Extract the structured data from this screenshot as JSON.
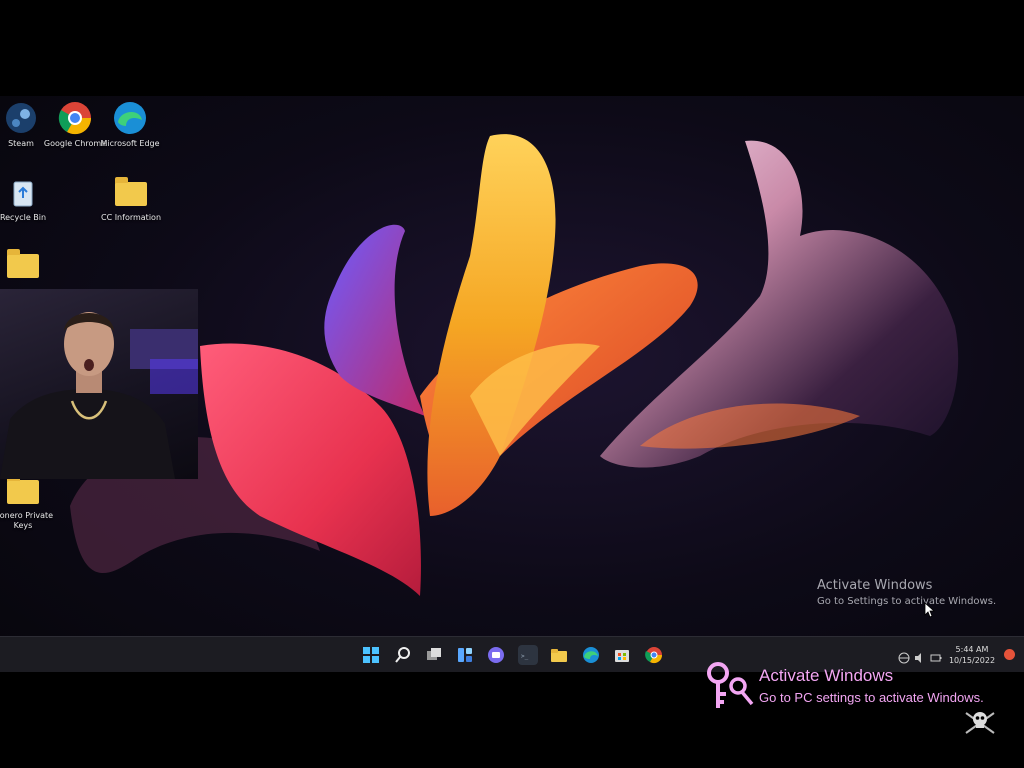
{
  "desktop": {
    "icons": [
      {
        "label": "Steam",
        "icon": "steam-icon"
      },
      {
        "label": "Google Chrome",
        "icon": "chrome-icon"
      },
      {
        "label": "Microsoft Edge",
        "icon": "edge-icon"
      },
      {
        "label": "Recycle Bin",
        "icon": "recycle-bin-icon"
      },
      {
        "label": "CC Information",
        "icon": "folder-icon"
      },
      {
        "label": "",
        "icon": "folder-icon"
      },
      {
        "label": "Monero Private Keys",
        "icon": "folder-icon"
      }
    ]
  },
  "watermark": {
    "title": "Activate Windows",
    "subtitle": "Go to Settings to activate Windows."
  },
  "taskbar": {
    "apps": [
      "windows-start-icon",
      "search-icon",
      "task-view-icon",
      "widgets-icon",
      "teams-chat-icon",
      "terminal-icon",
      "file-explorer-icon",
      "edge-icon",
      "store-icon",
      "chrome-icon"
    ],
    "time": "5:44 AM",
    "date": "10/15/2022"
  },
  "overlay": {
    "title": "Activate Windows",
    "subtitle": "Go to PC settings to activate Windows.",
    "icon": "key-icon",
    "color": "#f3a6f3"
  },
  "colors": {
    "taskbar": "#1c1c22",
    "folder": "#f2c94c",
    "accent_pink": "#f3a6f3"
  }
}
